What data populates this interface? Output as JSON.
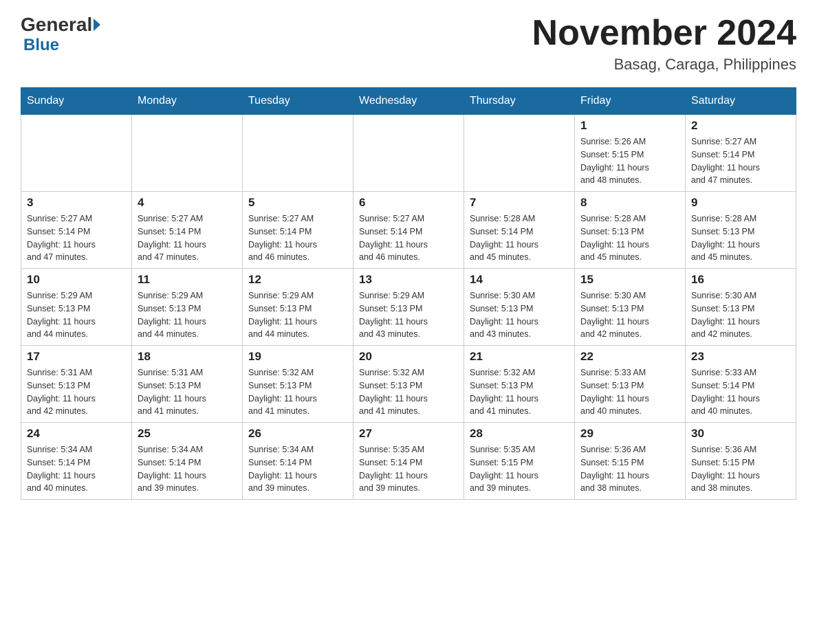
{
  "header": {
    "logo_general": "General",
    "logo_blue": "Blue",
    "month_title": "November 2024",
    "location": "Basag, Caraga, Philippines"
  },
  "weekdays": [
    "Sunday",
    "Monday",
    "Tuesday",
    "Wednesday",
    "Thursday",
    "Friday",
    "Saturday"
  ],
  "weeks": [
    [
      {
        "day": "",
        "info": ""
      },
      {
        "day": "",
        "info": ""
      },
      {
        "day": "",
        "info": ""
      },
      {
        "day": "",
        "info": ""
      },
      {
        "day": "",
        "info": ""
      },
      {
        "day": "1",
        "info": "Sunrise: 5:26 AM\nSunset: 5:15 PM\nDaylight: 11 hours\nand 48 minutes."
      },
      {
        "day": "2",
        "info": "Sunrise: 5:27 AM\nSunset: 5:14 PM\nDaylight: 11 hours\nand 47 minutes."
      }
    ],
    [
      {
        "day": "3",
        "info": "Sunrise: 5:27 AM\nSunset: 5:14 PM\nDaylight: 11 hours\nand 47 minutes."
      },
      {
        "day": "4",
        "info": "Sunrise: 5:27 AM\nSunset: 5:14 PM\nDaylight: 11 hours\nand 47 minutes."
      },
      {
        "day": "5",
        "info": "Sunrise: 5:27 AM\nSunset: 5:14 PM\nDaylight: 11 hours\nand 46 minutes."
      },
      {
        "day": "6",
        "info": "Sunrise: 5:27 AM\nSunset: 5:14 PM\nDaylight: 11 hours\nand 46 minutes."
      },
      {
        "day": "7",
        "info": "Sunrise: 5:28 AM\nSunset: 5:14 PM\nDaylight: 11 hours\nand 45 minutes."
      },
      {
        "day": "8",
        "info": "Sunrise: 5:28 AM\nSunset: 5:13 PM\nDaylight: 11 hours\nand 45 minutes."
      },
      {
        "day": "9",
        "info": "Sunrise: 5:28 AM\nSunset: 5:13 PM\nDaylight: 11 hours\nand 45 minutes."
      }
    ],
    [
      {
        "day": "10",
        "info": "Sunrise: 5:29 AM\nSunset: 5:13 PM\nDaylight: 11 hours\nand 44 minutes."
      },
      {
        "day": "11",
        "info": "Sunrise: 5:29 AM\nSunset: 5:13 PM\nDaylight: 11 hours\nand 44 minutes."
      },
      {
        "day": "12",
        "info": "Sunrise: 5:29 AM\nSunset: 5:13 PM\nDaylight: 11 hours\nand 44 minutes."
      },
      {
        "day": "13",
        "info": "Sunrise: 5:29 AM\nSunset: 5:13 PM\nDaylight: 11 hours\nand 43 minutes."
      },
      {
        "day": "14",
        "info": "Sunrise: 5:30 AM\nSunset: 5:13 PM\nDaylight: 11 hours\nand 43 minutes."
      },
      {
        "day": "15",
        "info": "Sunrise: 5:30 AM\nSunset: 5:13 PM\nDaylight: 11 hours\nand 42 minutes."
      },
      {
        "day": "16",
        "info": "Sunrise: 5:30 AM\nSunset: 5:13 PM\nDaylight: 11 hours\nand 42 minutes."
      }
    ],
    [
      {
        "day": "17",
        "info": "Sunrise: 5:31 AM\nSunset: 5:13 PM\nDaylight: 11 hours\nand 42 minutes."
      },
      {
        "day": "18",
        "info": "Sunrise: 5:31 AM\nSunset: 5:13 PM\nDaylight: 11 hours\nand 41 minutes."
      },
      {
        "day": "19",
        "info": "Sunrise: 5:32 AM\nSunset: 5:13 PM\nDaylight: 11 hours\nand 41 minutes."
      },
      {
        "day": "20",
        "info": "Sunrise: 5:32 AM\nSunset: 5:13 PM\nDaylight: 11 hours\nand 41 minutes."
      },
      {
        "day": "21",
        "info": "Sunrise: 5:32 AM\nSunset: 5:13 PM\nDaylight: 11 hours\nand 41 minutes."
      },
      {
        "day": "22",
        "info": "Sunrise: 5:33 AM\nSunset: 5:13 PM\nDaylight: 11 hours\nand 40 minutes."
      },
      {
        "day": "23",
        "info": "Sunrise: 5:33 AM\nSunset: 5:14 PM\nDaylight: 11 hours\nand 40 minutes."
      }
    ],
    [
      {
        "day": "24",
        "info": "Sunrise: 5:34 AM\nSunset: 5:14 PM\nDaylight: 11 hours\nand 40 minutes."
      },
      {
        "day": "25",
        "info": "Sunrise: 5:34 AM\nSunset: 5:14 PM\nDaylight: 11 hours\nand 39 minutes."
      },
      {
        "day": "26",
        "info": "Sunrise: 5:34 AM\nSunset: 5:14 PM\nDaylight: 11 hours\nand 39 minutes."
      },
      {
        "day": "27",
        "info": "Sunrise: 5:35 AM\nSunset: 5:14 PM\nDaylight: 11 hours\nand 39 minutes."
      },
      {
        "day": "28",
        "info": "Sunrise: 5:35 AM\nSunset: 5:15 PM\nDaylight: 11 hours\nand 39 minutes."
      },
      {
        "day": "29",
        "info": "Sunrise: 5:36 AM\nSunset: 5:15 PM\nDaylight: 11 hours\nand 38 minutes."
      },
      {
        "day": "30",
        "info": "Sunrise: 5:36 AM\nSunset: 5:15 PM\nDaylight: 11 hours\nand 38 minutes."
      }
    ]
  ]
}
